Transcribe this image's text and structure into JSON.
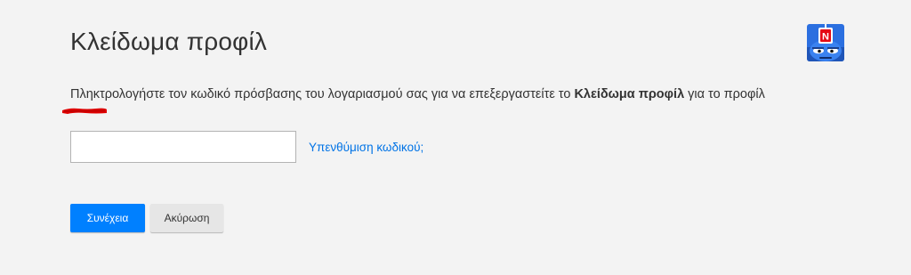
{
  "page": {
    "title": "Κλείδωμα προφίλ",
    "description_prefix": "Πληκτρολογήστε τον κωδικό πρόσβασης του λογαριασμού σας για να επεξεργαστείτε το ",
    "description_bold": "Κλείδωμα προφίλ",
    "description_suffix": " για το προφίλ"
  },
  "avatar": {
    "icon": "profile-avatar-icon",
    "badge_letter": "N",
    "colors": {
      "background": "#2b6fe0",
      "badge": "#e50914"
    }
  },
  "redaction": {
    "color": "#e00000"
  },
  "form": {
    "password_value": "",
    "forgot_password_label": "Υπενθύμιση κωδικού;"
  },
  "buttons": {
    "continue_label": "Συνέχεια",
    "cancel_label": "Ακύρωση"
  },
  "colors": {
    "background": "#f3f3f3",
    "accent": "#0080ff",
    "link": "#0073e6"
  }
}
